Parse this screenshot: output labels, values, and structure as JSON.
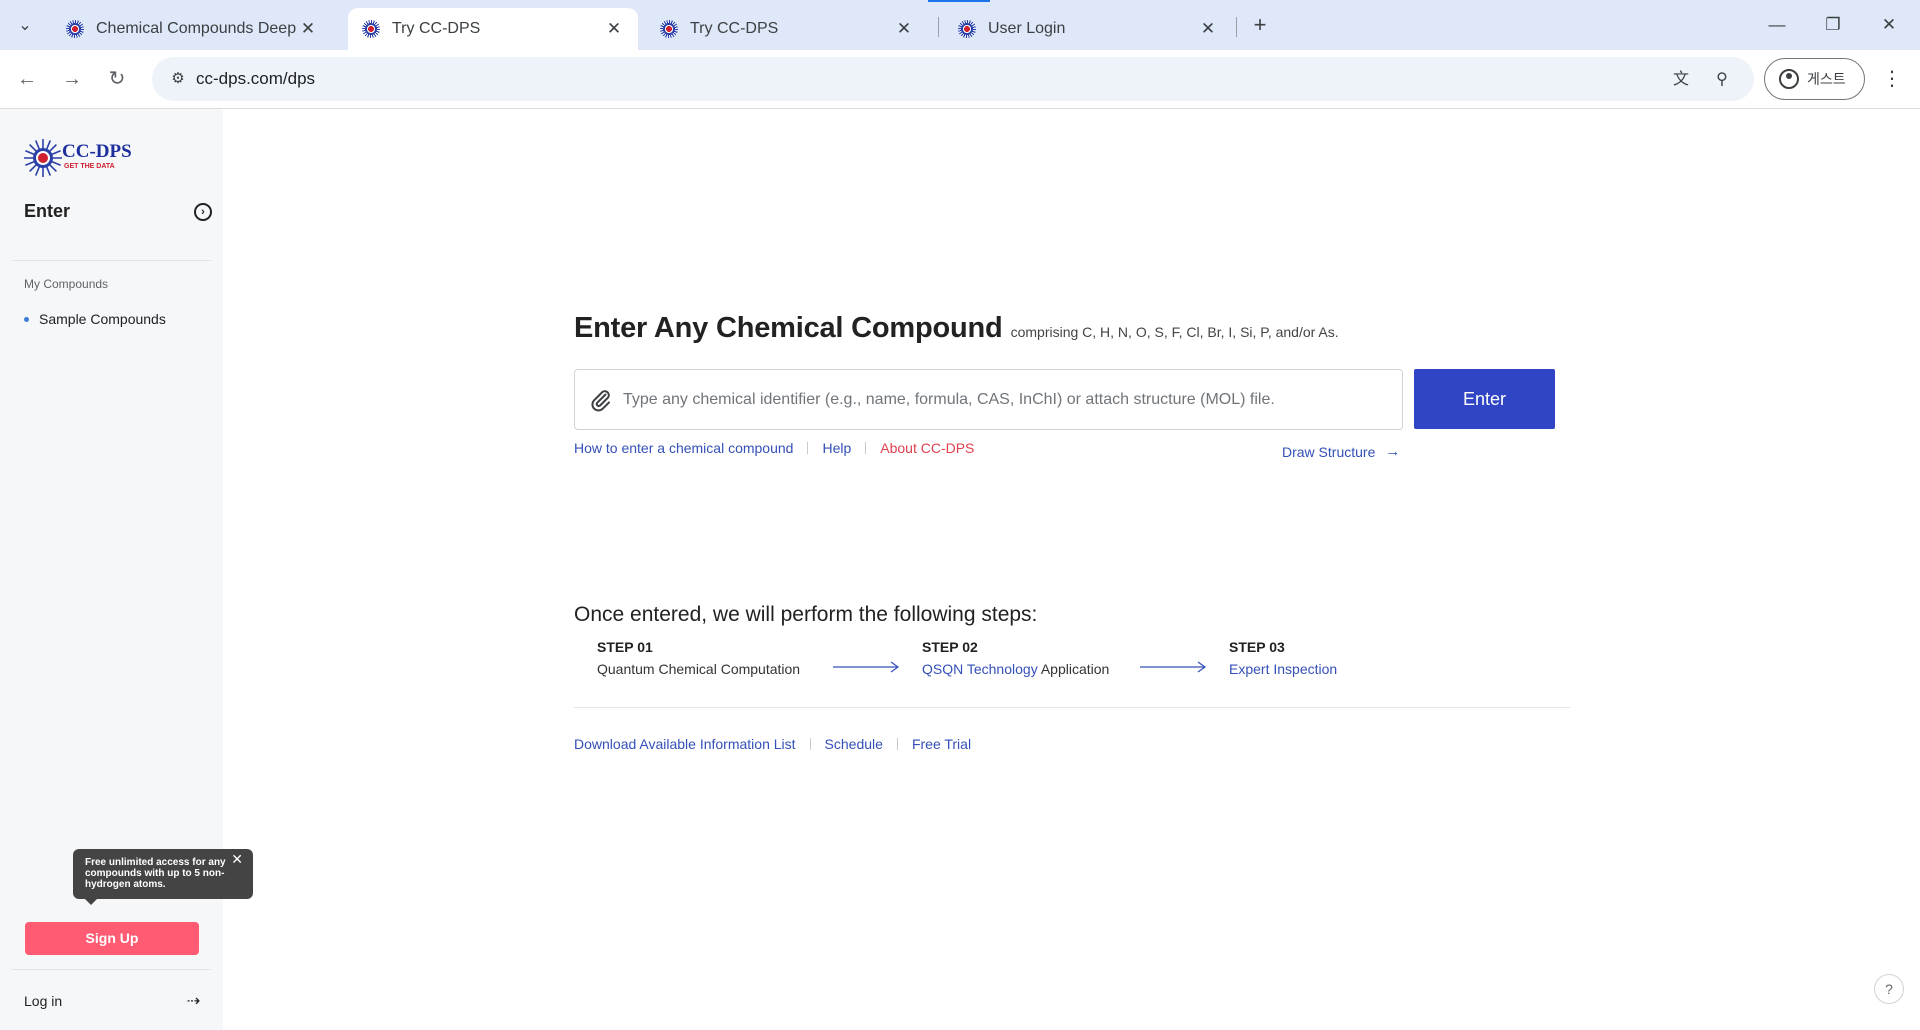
{
  "browser": {
    "tabs": [
      {
        "title": "Chemical Compounds Deep P",
        "active": false
      },
      {
        "title": "Try CC-DPS",
        "active": true
      },
      {
        "title": "Try CC-DPS",
        "active": false
      },
      {
        "title": "User Login",
        "active": false
      }
    ],
    "url": "cc-dps.com/dps",
    "profile_label": "게스트"
  },
  "sidebar": {
    "logo": {
      "name": "CC-DPS",
      "tagline": "GET THE DATA"
    },
    "enter_label": "Enter",
    "section_title": "My Compounds",
    "items": [
      {
        "label": "Sample Compounds"
      }
    ],
    "tooltip": {
      "text": "Free unlimited access for any compounds with up to 5 non-hydrogen atoms."
    },
    "signup_label": "Sign Up",
    "login_label": "Log in"
  },
  "main": {
    "headline": "Enter Any Chemical Compound",
    "subheadline": "comprising C, H, N, O, S, F, Cl, Br, I, Si, P, and/or As.",
    "search": {
      "placeholder": "Type any chemical identifier (e.g., name, formula, CAS, InChI) or attach structure (MOL) file.",
      "value": ""
    },
    "enter_button": "Enter",
    "help_links": [
      "How to enter a chemical compound",
      "Help",
      "About CC-DPS"
    ],
    "draw_structure": "Draw Structure",
    "steps_title": "Once entered, we will perform the following steps:",
    "steps": [
      {
        "number": "STEP 01",
        "name": "Quantum Chemical Computation"
      },
      {
        "number": "STEP 02",
        "name_highlight": "QSQN Technology",
        "name_rest": " Application"
      },
      {
        "number": "STEP 03",
        "name": "Expert Inspection"
      }
    ],
    "footer_links": [
      "Download Available Information List",
      "Schedule",
      "Free Trial"
    ],
    "help_fab": "?"
  },
  "colors": {
    "accent_blue": "#2f45c5",
    "link_blue": "#3450b8",
    "signup_pink": "#ff5b72",
    "about_red": "#e0404f"
  }
}
